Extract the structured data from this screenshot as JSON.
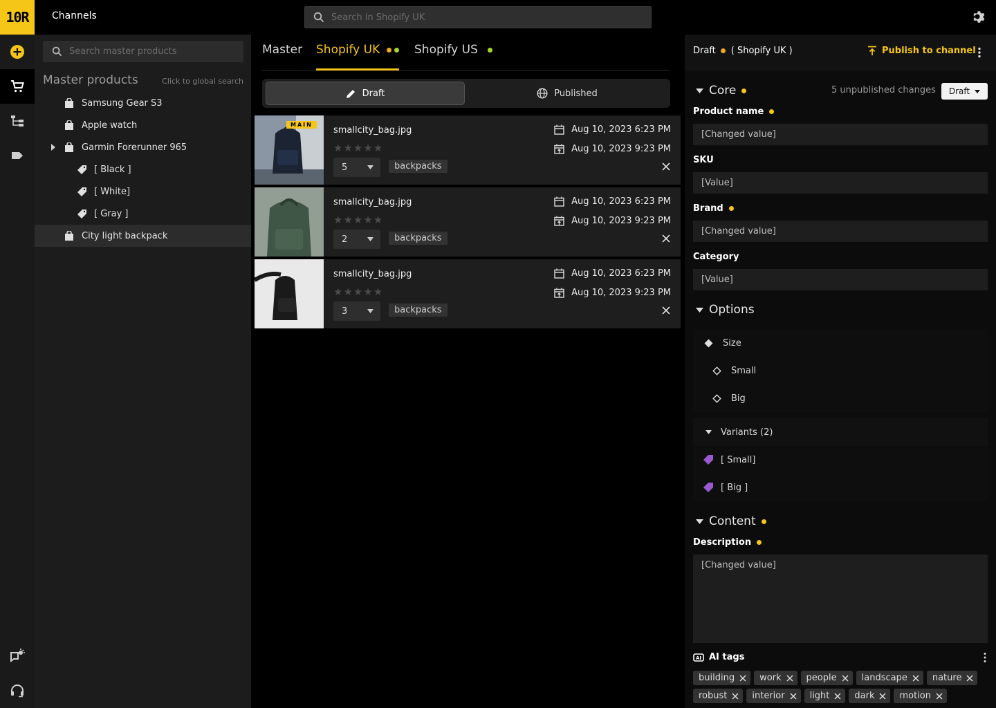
{
  "app": {
    "logo_text": "10R",
    "title": "Channels"
  },
  "header": {
    "search_placeholder": "Search in Shopify UK"
  },
  "sidebar": {
    "search_placeholder": "Search master products",
    "heading": "Master products",
    "heading_hint": "Click to global search",
    "items": [
      {
        "label": "Samsung Gear S3",
        "type": "product"
      },
      {
        "label": "Apple watch",
        "type": "product"
      },
      {
        "label": "Garmin Forerunner 965",
        "type": "product",
        "expandable": true
      },
      {
        "label": "[ Black ]",
        "type": "variant"
      },
      {
        "label": "[ White]",
        "type": "variant"
      },
      {
        "label": "[ Gray ]",
        "type": "variant"
      },
      {
        "label": "City light backpack",
        "type": "product",
        "selected": true
      }
    ]
  },
  "tabs": [
    {
      "label": "Master"
    },
    {
      "label": "Shopify UK",
      "active": true,
      "dots": [
        "orange",
        "green"
      ]
    },
    {
      "label": "Shopify US",
      "dots": [
        "green"
      ]
    }
  ],
  "segment": {
    "draft": "Draft",
    "published": "Published",
    "active": "draft"
  },
  "assets": [
    {
      "filename": "smallcity_bag.jpg",
      "badge": "MAIN",
      "rating": 0,
      "qty": "5",
      "tag": "backpacks",
      "created": "Aug 10, 2023 6:23 PM",
      "scheduled": "Aug 10, 2023 9:23 PM"
    },
    {
      "filename": "smallcity_bag.jpg",
      "rating": 0,
      "qty": "2",
      "tag": "backpacks",
      "created": "Aug 10, 2023 6:23 PM",
      "scheduled": "Aug 10, 2023 9:23 PM"
    },
    {
      "filename": "smallcity_bag.jpg",
      "rating": 0,
      "qty": "3",
      "tag": "backpacks",
      "created": "Aug 10, 2023 6:23 PM",
      "scheduled": "Aug 10, 2023 9:23 PM"
    }
  ],
  "panel": {
    "status": "Draft",
    "channel": "( Shopify UK )",
    "publish_label": "Publish to channel",
    "core": {
      "title": "Core",
      "unpublished": "5 unpublished changes",
      "state": "Draft",
      "fields": [
        {
          "label": "Product name",
          "value": "[Changed value]",
          "changed": true
        },
        {
          "label": "SKU",
          "value": "[Value]",
          "changed": false
        },
        {
          "label": "Brand",
          "value": "[Changed value]",
          "changed": true
        },
        {
          "label": "Category",
          "value": "[Value]",
          "changed": false
        }
      ]
    },
    "options": {
      "title": "Options",
      "option_name": "Size",
      "values": [
        "Small",
        "Big"
      ],
      "variants_label": "Variants (2)",
      "variants": [
        "[ Small]",
        "[ Big ]"
      ]
    },
    "content": {
      "title": "Content",
      "description_label": "Description",
      "description_value": "[Changed value]"
    },
    "ai_tags": {
      "title": "AI tags",
      "tags": [
        "building",
        "work",
        "people",
        "landscape",
        "nature",
        "robust",
        "interior",
        "light",
        "dark",
        "motion"
      ]
    }
  },
  "colors": {
    "accent": "#f5c518",
    "changed_dot": "#f5a623",
    "published_dot": "#a6d42a",
    "variant_tag": "#9b59d0"
  }
}
